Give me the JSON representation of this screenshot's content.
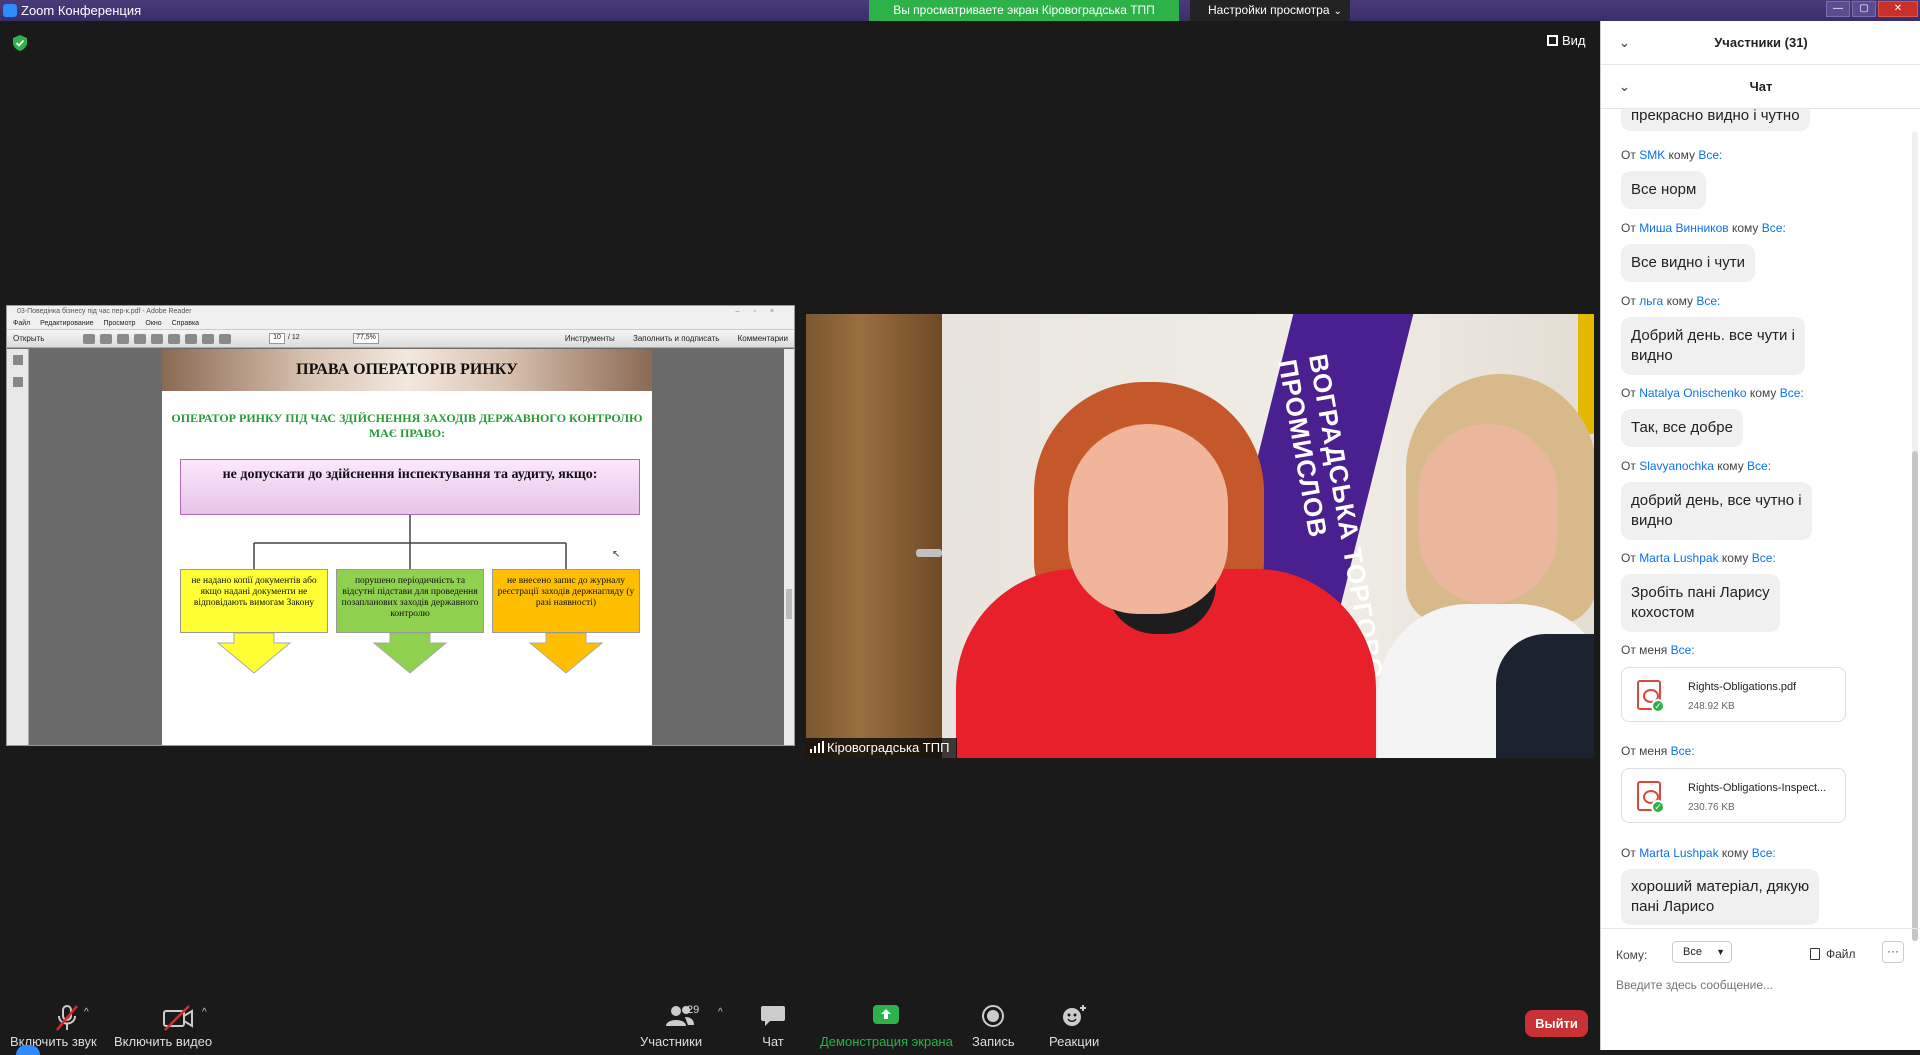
{
  "window": {
    "title": "Zoom Конференция",
    "share_banner": "Вы просматриваете экран Кіровоградська ТПП",
    "view_options": "Настройки просмотра",
    "view_button": "Вид"
  },
  "shared_screen": {
    "reader_title": "03-Поведінка бізнесу під час пер-к.pdf - Adobe Reader",
    "menu": [
      "Файл",
      "Редактирование",
      "Просмотр",
      "Окно",
      "Справка"
    ],
    "open_label": "Открыть",
    "page_current": "10",
    "page_total": "/ 12",
    "zoom": "77,5%",
    "right_links": [
      "Инструменты",
      "Заполнить и подписать",
      "Комментарии"
    ],
    "slide": {
      "title": "ПРАВА ОПЕРАТОРІВ РИНКУ",
      "subtitle": "ОПЕРАТОР РИНКУ ПІД ЧАС ЗДІЙСНЕННЯ ЗАХОДІВ ДЕРЖАВНОГО КОНТРОЛЮ МАЄ ПРАВО:",
      "main": "не допускати до здійснення інспектування та аудиту, якщо:",
      "box1": "не надано копії документів або якщо надані документи не відповідають вимогам Закону",
      "box2": "порушено періодичність та відсутні підстави для проведення позапланових заходів державного контролю",
      "box3": "не внесено запис до журналу реєстрації заходів держнагляду (у разі наявності)",
      "colors": {
        "box1": "#ffff33",
        "box2": "#8fd14f",
        "box3": "#ffbf00"
      }
    }
  },
  "video": {
    "participant_name": "Кіровоградська ТПП",
    "flag_text": "ВОГРАДСЬКА ТОРГОВО-ПРОМИСЛОВ"
  },
  "toolbar": {
    "mute": "Включить звук",
    "video": "Включить видео",
    "participants": "Участники",
    "participants_count": "29",
    "chat": "Чат",
    "share": "Демонстрация экрана",
    "record": "Запись",
    "reactions": "Реакции",
    "leave": "Выйти",
    "share_color": "#2db24a",
    "leave_color": "#c93235"
  },
  "panel": {
    "participants_header": "Участники (31)",
    "chat_header": "Чат",
    "messages": [
      {
        "type": "text",
        "text": "прекрасно видно і чутно"
      },
      {
        "type": "header",
        "from": "От",
        "name": "SMK",
        "to": "кому",
        "target": "Все:"
      },
      {
        "type": "text",
        "text": "Все норм"
      },
      {
        "type": "header",
        "from": "От",
        "name": "Миша Винников",
        "to": "кому",
        "target": "Все:"
      },
      {
        "type": "text",
        "text": "Все видно і чути"
      },
      {
        "type": "header",
        "from": "От",
        "name": "льга",
        "to": "кому",
        "target": "Все:"
      },
      {
        "type": "text",
        "text": "Добрий день. все чути і",
        "text2": "видно"
      },
      {
        "type": "header",
        "from": "От",
        "name": "Natalya  Onischenko",
        "to": "кому",
        "target": "Все:"
      },
      {
        "type": "text",
        "text": "Так, все добре"
      },
      {
        "type": "header",
        "from": "От",
        "name": "Slavyanochka",
        "to": "кому",
        "target": "Все:"
      },
      {
        "type": "text",
        "text": "добрий день, все чутно і",
        "text2": "видно"
      },
      {
        "type": "header",
        "from": "От",
        "name": "Marta Lushpak",
        "to": "кому",
        "target": "Все:"
      },
      {
        "type": "text",
        "text": "Зробіть пані Ларису",
        "text2": "кохостом"
      },
      {
        "type": "header",
        "from": "От меня",
        "name": "",
        "to": "",
        "target": "Все:"
      },
      {
        "type": "file",
        "name": "Rights-Obligations.pdf",
        "size": "248.92 KB"
      },
      {
        "type": "header",
        "from": "От меня",
        "name": "",
        "to": "",
        "target": "Все:"
      },
      {
        "type": "file",
        "name": "Rights-Obligations-Inspect...",
        "size": "230.76 KB"
      },
      {
        "type": "header",
        "from": "От",
        "name": "Marta Lushpak",
        "to": "кому",
        "target": "Все:"
      },
      {
        "type": "text",
        "text": "хороший матеріал, дякую",
        "text2": "пані Ларисо"
      }
    ],
    "to_label": "Кому:",
    "to_value": "Все",
    "file_button": "Файл",
    "more_button": "···",
    "input_placeholder": "Введите здесь сообщение..."
  }
}
